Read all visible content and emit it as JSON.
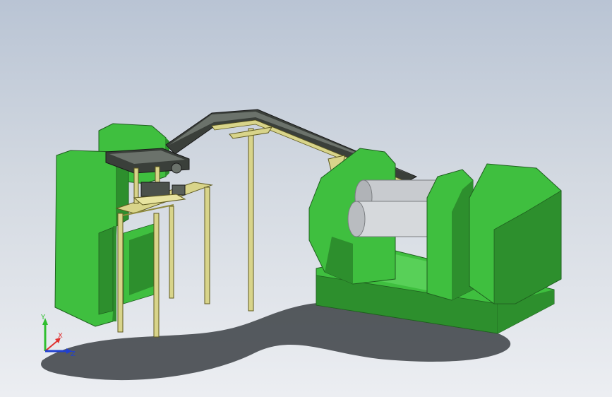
{
  "viewport": {
    "name": "3d-model-viewport"
  },
  "model": {
    "colors": {
      "machine_green": "#3fbf3f",
      "machine_green_dark": "#2d8f2d",
      "machine_green_light": "#58d058",
      "frame_yellow": "#d8d48a",
      "frame_yellow_dark": "#8f8a3c",
      "conveyor_dark": "#3a3f3a",
      "roller_gray": "#c8cbcf",
      "shadow": "#3b3f44"
    }
  },
  "triad": {
    "y_label": "Y",
    "x_label": "X",
    "z_label": "Z",
    "colors": {
      "y": "#2fbf2f",
      "x": "#e03030",
      "z": "#2040d0"
    }
  }
}
